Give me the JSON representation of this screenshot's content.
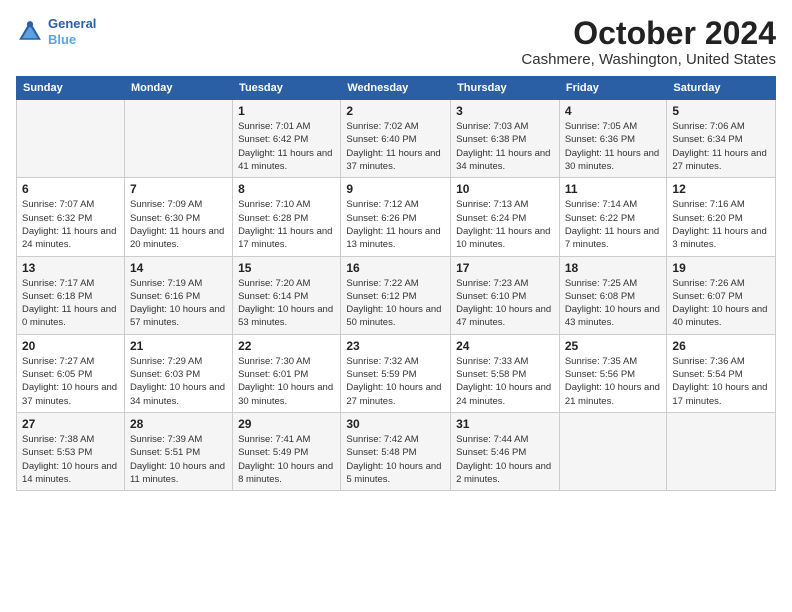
{
  "logo": {
    "line1": "General",
    "line2": "Blue",
    "icon_color": "#2b5fa5"
  },
  "title": "October 2024",
  "location": "Cashmere, Washington, United States",
  "header_color": "#2b5fa5",
  "days_of_week": [
    "Sunday",
    "Monday",
    "Tuesday",
    "Wednesday",
    "Thursday",
    "Friday",
    "Saturday"
  ],
  "weeks": [
    [
      {
        "day": "",
        "sunrise": "",
        "sunset": "",
        "daylight": ""
      },
      {
        "day": "",
        "sunrise": "",
        "sunset": "",
        "daylight": ""
      },
      {
        "day": "1",
        "sunrise": "Sunrise: 7:01 AM",
        "sunset": "Sunset: 6:42 PM",
        "daylight": "Daylight: 11 hours and 41 minutes."
      },
      {
        "day": "2",
        "sunrise": "Sunrise: 7:02 AM",
        "sunset": "Sunset: 6:40 PM",
        "daylight": "Daylight: 11 hours and 37 minutes."
      },
      {
        "day": "3",
        "sunrise": "Sunrise: 7:03 AM",
        "sunset": "Sunset: 6:38 PM",
        "daylight": "Daylight: 11 hours and 34 minutes."
      },
      {
        "day": "4",
        "sunrise": "Sunrise: 7:05 AM",
        "sunset": "Sunset: 6:36 PM",
        "daylight": "Daylight: 11 hours and 30 minutes."
      },
      {
        "day": "5",
        "sunrise": "Sunrise: 7:06 AM",
        "sunset": "Sunset: 6:34 PM",
        "daylight": "Daylight: 11 hours and 27 minutes."
      }
    ],
    [
      {
        "day": "6",
        "sunrise": "Sunrise: 7:07 AM",
        "sunset": "Sunset: 6:32 PM",
        "daylight": "Daylight: 11 hours and 24 minutes."
      },
      {
        "day": "7",
        "sunrise": "Sunrise: 7:09 AM",
        "sunset": "Sunset: 6:30 PM",
        "daylight": "Daylight: 11 hours and 20 minutes."
      },
      {
        "day": "8",
        "sunrise": "Sunrise: 7:10 AM",
        "sunset": "Sunset: 6:28 PM",
        "daylight": "Daylight: 11 hours and 17 minutes."
      },
      {
        "day": "9",
        "sunrise": "Sunrise: 7:12 AM",
        "sunset": "Sunset: 6:26 PM",
        "daylight": "Daylight: 11 hours and 13 minutes."
      },
      {
        "day": "10",
        "sunrise": "Sunrise: 7:13 AM",
        "sunset": "Sunset: 6:24 PM",
        "daylight": "Daylight: 11 hours and 10 minutes."
      },
      {
        "day": "11",
        "sunrise": "Sunrise: 7:14 AM",
        "sunset": "Sunset: 6:22 PM",
        "daylight": "Daylight: 11 hours and 7 minutes."
      },
      {
        "day": "12",
        "sunrise": "Sunrise: 7:16 AM",
        "sunset": "Sunset: 6:20 PM",
        "daylight": "Daylight: 11 hours and 3 minutes."
      }
    ],
    [
      {
        "day": "13",
        "sunrise": "Sunrise: 7:17 AM",
        "sunset": "Sunset: 6:18 PM",
        "daylight": "Daylight: 11 hours and 0 minutes."
      },
      {
        "day": "14",
        "sunrise": "Sunrise: 7:19 AM",
        "sunset": "Sunset: 6:16 PM",
        "daylight": "Daylight: 10 hours and 57 minutes."
      },
      {
        "day": "15",
        "sunrise": "Sunrise: 7:20 AM",
        "sunset": "Sunset: 6:14 PM",
        "daylight": "Daylight: 10 hours and 53 minutes."
      },
      {
        "day": "16",
        "sunrise": "Sunrise: 7:22 AM",
        "sunset": "Sunset: 6:12 PM",
        "daylight": "Daylight: 10 hours and 50 minutes."
      },
      {
        "day": "17",
        "sunrise": "Sunrise: 7:23 AM",
        "sunset": "Sunset: 6:10 PM",
        "daylight": "Daylight: 10 hours and 47 minutes."
      },
      {
        "day": "18",
        "sunrise": "Sunrise: 7:25 AM",
        "sunset": "Sunset: 6:08 PM",
        "daylight": "Daylight: 10 hours and 43 minutes."
      },
      {
        "day": "19",
        "sunrise": "Sunrise: 7:26 AM",
        "sunset": "Sunset: 6:07 PM",
        "daylight": "Daylight: 10 hours and 40 minutes."
      }
    ],
    [
      {
        "day": "20",
        "sunrise": "Sunrise: 7:27 AM",
        "sunset": "Sunset: 6:05 PM",
        "daylight": "Daylight: 10 hours and 37 minutes."
      },
      {
        "day": "21",
        "sunrise": "Sunrise: 7:29 AM",
        "sunset": "Sunset: 6:03 PM",
        "daylight": "Daylight: 10 hours and 34 minutes."
      },
      {
        "day": "22",
        "sunrise": "Sunrise: 7:30 AM",
        "sunset": "Sunset: 6:01 PM",
        "daylight": "Daylight: 10 hours and 30 minutes."
      },
      {
        "day": "23",
        "sunrise": "Sunrise: 7:32 AM",
        "sunset": "Sunset: 5:59 PM",
        "daylight": "Daylight: 10 hours and 27 minutes."
      },
      {
        "day": "24",
        "sunrise": "Sunrise: 7:33 AM",
        "sunset": "Sunset: 5:58 PM",
        "daylight": "Daylight: 10 hours and 24 minutes."
      },
      {
        "day": "25",
        "sunrise": "Sunrise: 7:35 AM",
        "sunset": "Sunset: 5:56 PM",
        "daylight": "Daylight: 10 hours and 21 minutes."
      },
      {
        "day": "26",
        "sunrise": "Sunrise: 7:36 AM",
        "sunset": "Sunset: 5:54 PM",
        "daylight": "Daylight: 10 hours and 17 minutes."
      }
    ],
    [
      {
        "day": "27",
        "sunrise": "Sunrise: 7:38 AM",
        "sunset": "Sunset: 5:53 PM",
        "daylight": "Daylight: 10 hours and 14 minutes."
      },
      {
        "day": "28",
        "sunrise": "Sunrise: 7:39 AM",
        "sunset": "Sunset: 5:51 PM",
        "daylight": "Daylight: 10 hours and 11 minutes."
      },
      {
        "day": "29",
        "sunrise": "Sunrise: 7:41 AM",
        "sunset": "Sunset: 5:49 PM",
        "daylight": "Daylight: 10 hours and 8 minutes."
      },
      {
        "day": "30",
        "sunrise": "Sunrise: 7:42 AM",
        "sunset": "Sunset: 5:48 PM",
        "daylight": "Daylight: 10 hours and 5 minutes."
      },
      {
        "day": "31",
        "sunrise": "Sunrise: 7:44 AM",
        "sunset": "Sunset: 5:46 PM",
        "daylight": "Daylight: 10 hours and 2 minutes."
      },
      {
        "day": "",
        "sunrise": "",
        "sunset": "",
        "daylight": ""
      },
      {
        "day": "",
        "sunrise": "",
        "sunset": "",
        "daylight": ""
      }
    ]
  ]
}
